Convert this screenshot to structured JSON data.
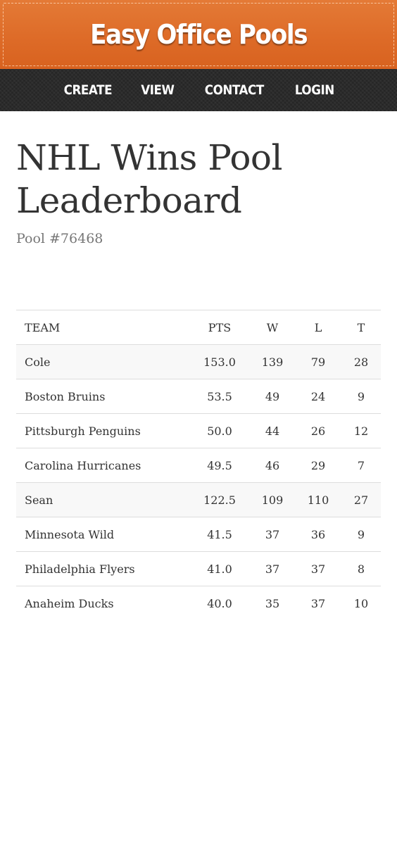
{
  "site": {
    "title": "Easy Office Pools"
  },
  "nav": {
    "items": [
      {
        "label": "CREATE"
      },
      {
        "label": "VIEW"
      },
      {
        "label": "CONTACT"
      },
      {
        "label": "LOGIN"
      }
    ]
  },
  "page": {
    "title_line1": "NHL Wins Pool",
    "title_line2": "Leaderboard",
    "pool_id": "Pool #76468"
  },
  "table": {
    "headers": {
      "team": "TEAM",
      "pts": "PTS",
      "w": "W",
      "l": "L",
      "t": "T"
    },
    "rows": [
      {
        "team": "Cole",
        "pts": "153.0",
        "w": "139",
        "l": "79",
        "t": "28",
        "player": true
      },
      {
        "team": "Boston Bruins",
        "pts": "53.5",
        "w": "49",
        "l": "24",
        "t": "9",
        "player": false
      },
      {
        "team": "Pittsburgh Penguins",
        "pts": "50.0",
        "w": "44",
        "l": "26",
        "t": "12",
        "player": false
      },
      {
        "team": "Carolina Hurricanes",
        "pts": "49.5",
        "w": "46",
        "l": "29",
        "t": "7",
        "player": false
      },
      {
        "team": "Sean",
        "pts": "122.5",
        "w": "109",
        "l": "110",
        "t": "27",
        "player": true
      },
      {
        "team": "Minnesota Wild",
        "pts": "41.5",
        "w": "37",
        "l": "36",
        "t": "9",
        "player": false
      },
      {
        "team": "Philadelphia Flyers",
        "pts": "41.0",
        "w": "37",
        "l": "37",
        "t": "8",
        "player": false
      },
      {
        "team": "Anaheim Ducks",
        "pts": "40.0",
        "w": "35",
        "l": "37",
        "t": "10",
        "player": false
      }
    ]
  }
}
